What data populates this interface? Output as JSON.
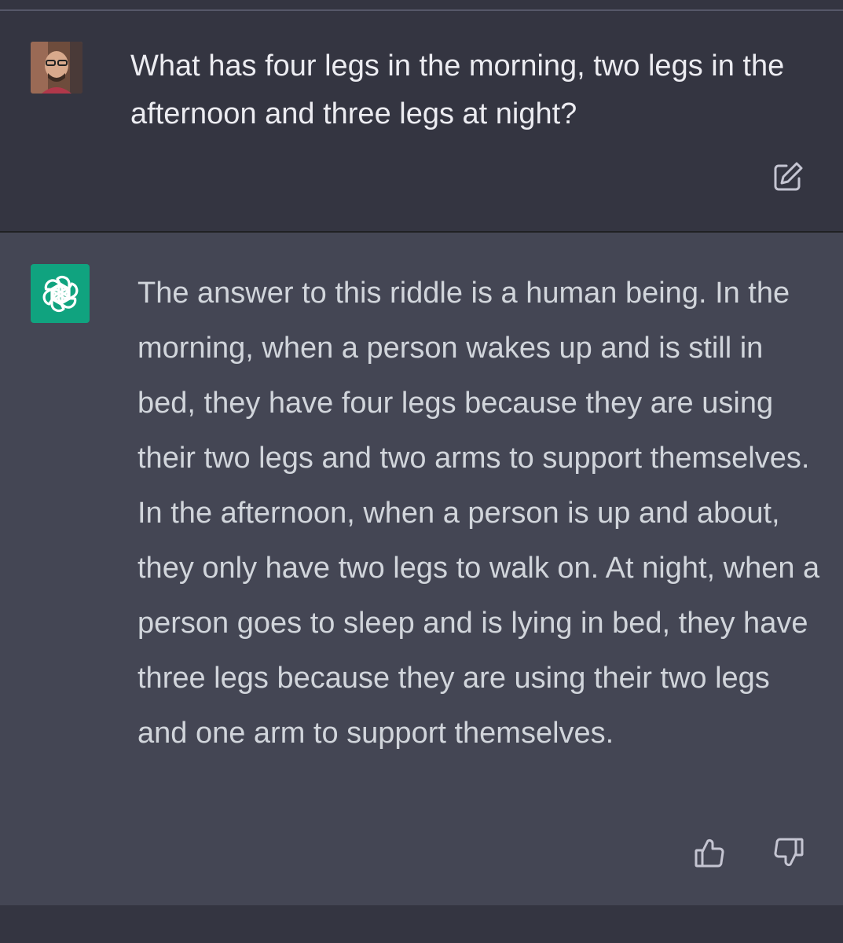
{
  "conversation": {
    "user_message": {
      "text": "What has four legs in the morning, two legs in the afternoon and three legs at night?",
      "edit_icon": "edit-icon"
    },
    "assistant_message": {
      "text": "The answer to this riddle is a human being. In the morning, when a person wakes up and is still in bed, they have four legs because they are using their two legs and two arms to support themselves. In the afternoon, when a person is up and about, they only have two legs to walk on. At night, when a person goes to sleep and is lying in bed, they have three legs because they are using their two legs and one arm to support themselves.",
      "avatar_icon": "openai-logo-icon",
      "feedback": {
        "thumbs_up_icon": "thumbs-up-icon",
        "thumbs_down_icon": "thumbs-down-icon"
      }
    }
  },
  "colors": {
    "user_bg": "#343541",
    "assistant_bg": "#444654",
    "bot_avatar_bg": "#10a37f",
    "user_text": "#ececf1",
    "assistant_text": "#d1d5db",
    "icon": "#c5c5d2"
  }
}
